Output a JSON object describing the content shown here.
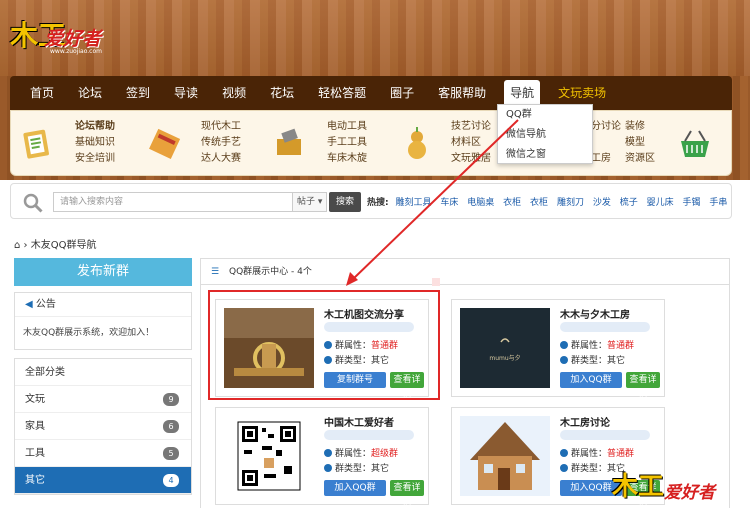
{
  "site": {
    "logo_main": "木工",
    "logo_sub": "爱好者",
    "logo_url": "www.zuojiao.com",
    "watermark_main": "木工",
    "watermark_sub": "爱好者"
  },
  "nav": {
    "items": [
      "首页",
      "论坛",
      "签到",
      "导读",
      "视频",
      "花坛",
      "轻松答题",
      "圈子",
      "客服帮助",
      "导航",
      "文玩卖场"
    ],
    "active_index": 9,
    "accent_index": 10
  },
  "dropdown": {
    "items": [
      "QQ群",
      "微信导航",
      "微信之窗"
    ]
  },
  "subnav": {
    "group1": [
      "论坛帮助",
      "基础知识",
      "安全培训"
    ],
    "group2": [
      "现代木工",
      "传统手艺",
      "达人大赛"
    ],
    "group3": [
      "电动工具",
      "手工工具",
      "车床木旋"
    ],
    "group4": [
      "技艺讨论",
      "材料区",
      "文玩雅居"
    ],
    "group5": [
      "分讨论",
      "工房"
    ],
    "group6": [
      "装修",
      "模型",
      "资源区"
    ]
  },
  "search": {
    "placeholder": "请输入搜索内容",
    "select": "帖子",
    "button": "搜索",
    "hot_label": "热搜:",
    "hot_terms": [
      "雕刻工具",
      "车床",
      "电脑桌",
      "衣柜",
      "衣柜",
      "雕刻刀",
      "沙发",
      "梳子",
      "婴儿床",
      "手镯",
      "手串"
    ]
  },
  "breadcrumb": "木友QQ群导航",
  "sidebar": {
    "publish_button": "发布新群",
    "notice_title": "公告",
    "notice_text": "木友QQ群展示系统，欢迎加入！",
    "categories": [
      {
        "label": "全部分类",
        "count": ""
      },
      {
        "label": "文玩",
        "count": "9"
      },
      {
        "label": "家具",
        "count": "6"
      },
      {
        "label": "工具",
        "count": "5"
      },
      {
        "label": "其它",
        "count": "4"
      }
    ],
    "active_category": 4
  },
  "main": {
    "header": "QQ群展示中心 - 4个",
    "attr_label_prop": "群属性：",
    "attr_label_type": "群类型：",
    "cards": [
      {
        "title": "木工机图交流分享",
        "prop": "普通群",
        "type": "其它",
        "btn1": "复制群号",
        "btn2": "查看详情"
      },
      {
        "title": "木木与夕木工房",
        "prop": "普通群",
        "type": "其它",
        "btn1": "加入QQ群",
        "btn2": "查看详情",
        "thumb_text": "mumu与夕"
      },
      {
        "title": "中国木工爱好者",
        "prop": "超级群",
        "type": "其它",
        "btn1": "加入QQ群",
        "btn2": "查看详情"
      },
      {
        "title": "木工房讨论",
        "prop": "普通群",
        "type": "其它",
        "btn1": "加入QQ群",
        "btn2": "查看详情"
      }
    ]
  }
}
